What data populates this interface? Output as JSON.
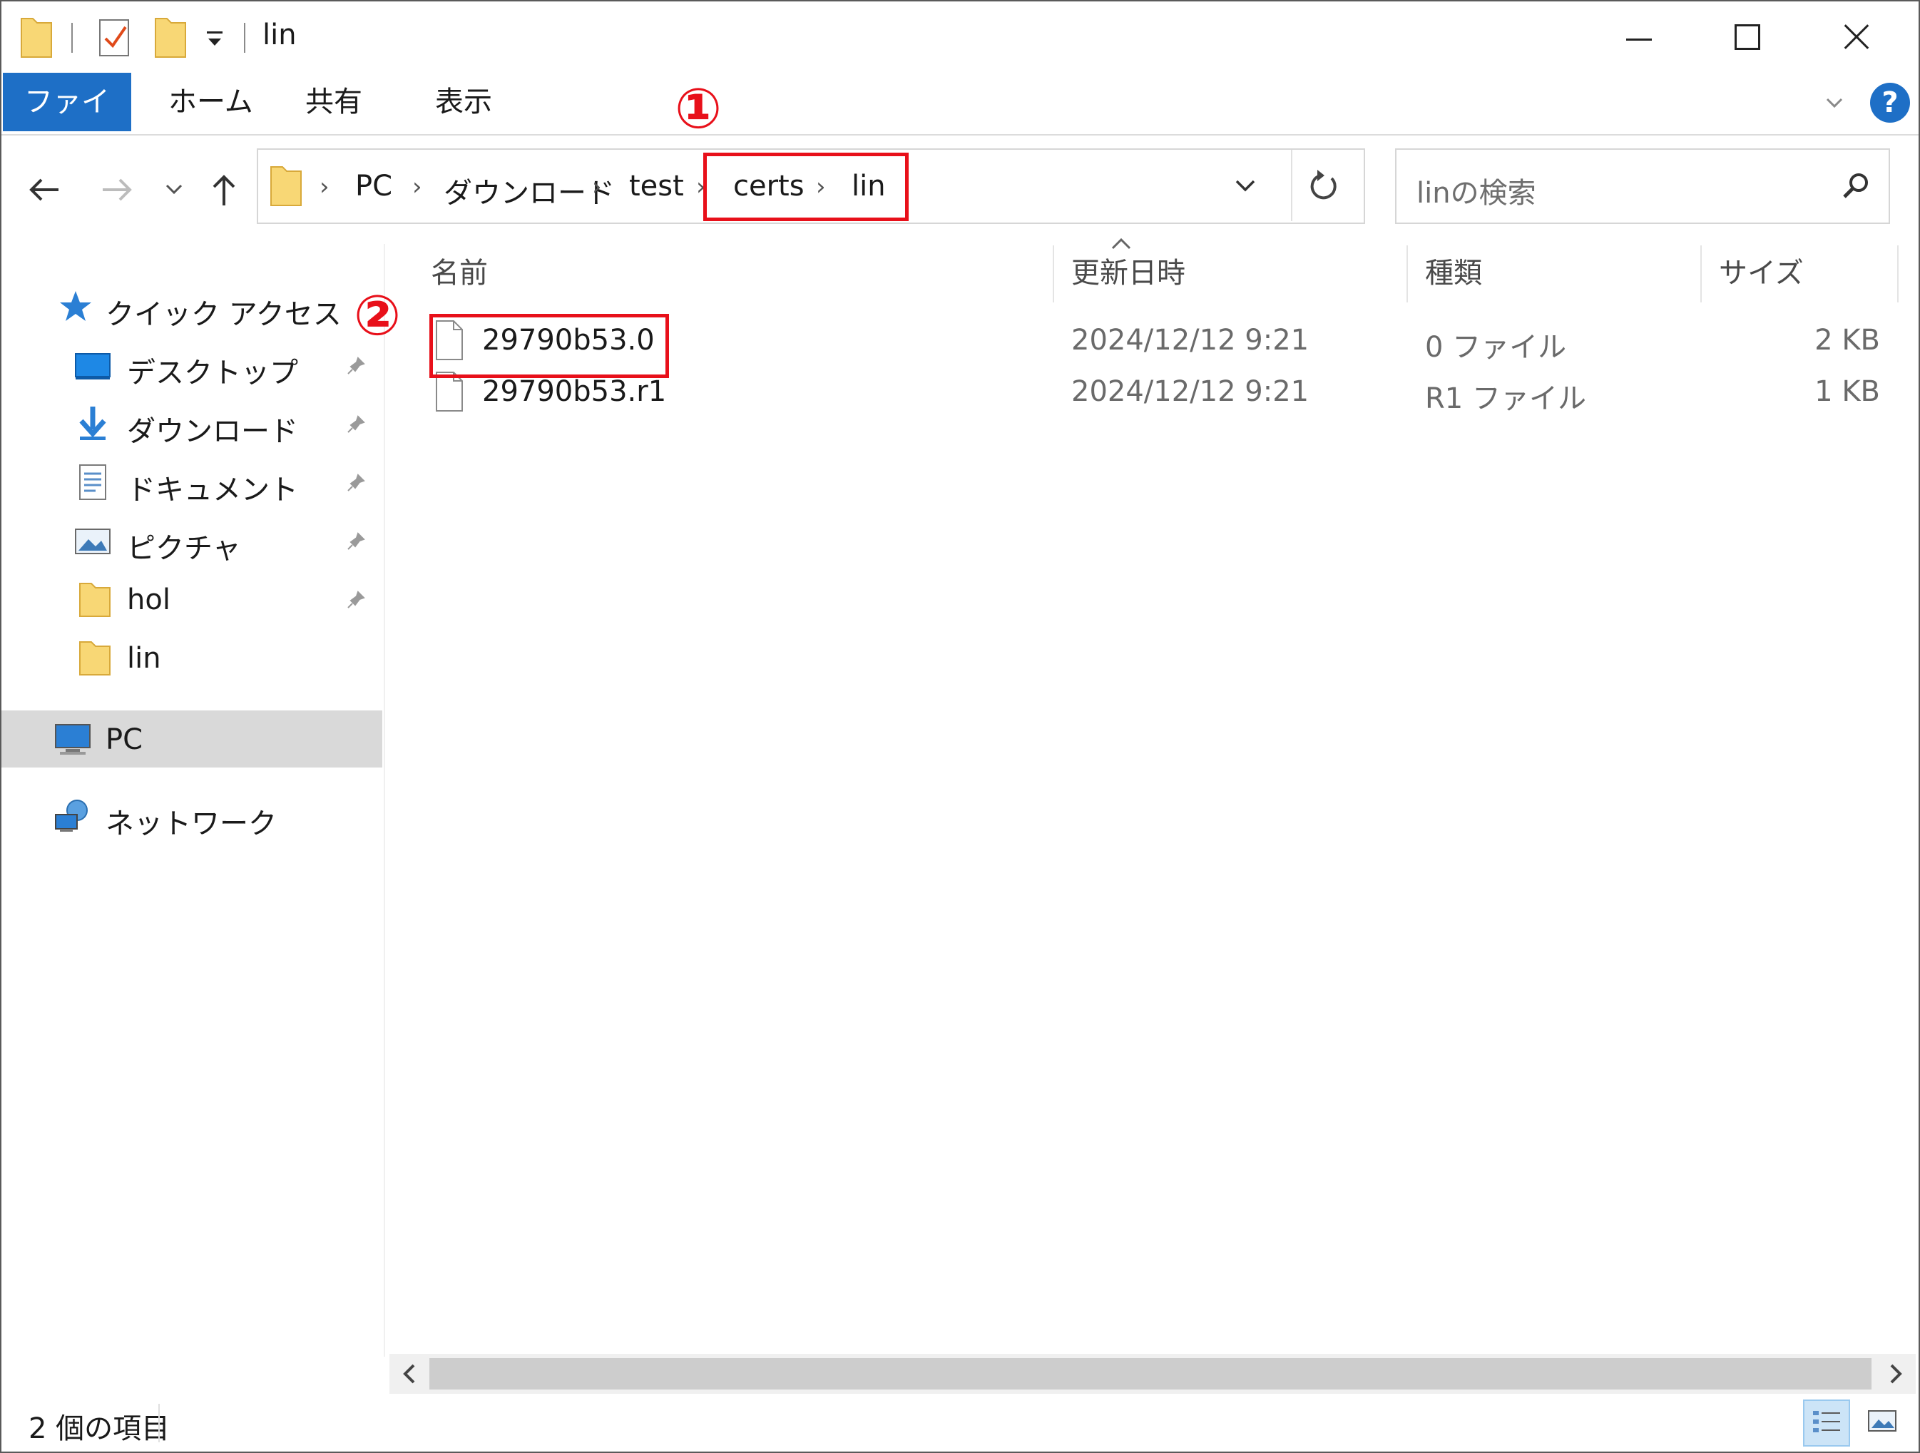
{
  "window": {
    "title": "lin"
  },
  "ribbon": {
    "tabs": [
      {
        "label": "ファイル"
      },
      {
        "label": "ホーム"
      },
      {
        "label": "共有"
      },
      {
        "label": "表示"
      }
    ],
    "help_label": "?"
  },
  "address": {
    "crumbs": [
      "PC",
      "ダウンロード",
      "test",
      "certs",
      "lin"
    ],
    "search_placeholder": "linの検索"
  },
  "sidebar": {
    "quick_access": "クイック アクセス",
    "items": [
      {
        "label": "デスクトップ",
        "icon": "desktop-icon",
        "pinned": true
      },
      {
        "label": "ダウンロード",
        "icon": "download-icon",
        "pinned": true
      },
      {
        "label": "ドキュメント",
        "icon": "document-icon",
        "pinned": true
      },
      {
        "label": "ピクチャ",
        "icon": "pictures-icon",
        "pinned": true
      },
      {
        "label": "hol",
        "icon": "folder-icon",
        "pinned": true
      },
      {
        "label": "lin",
        "icon": "folder-icon",
        "pinned": false
      }
    ],
    "pc": "PC",
    "network": "ネットワーク"
  },
  "columns": [
    "名前",
    "更新日時",
    "種類",
    "サイズ"
  ],
  "files": [
    {
      "name": "29790b53.0",
      "date": "2024/12/12 9:21",
      "type": "0 ファイル",
      "size": "2 KB"
    },
    {
      "name": "29790b53.r1",
      "date": "2024/12/12 9:21",
      "type": "R1 ファイル",
      "size": "1 KB"
    }
  ],
  "annotations": [
    "①",
    "②"
  ],
  "status": {
    "item_count": "2 個の項目"
  },
  "colors": {
    "accent": "#1e6fc6",
    "annotation": "#e8101a",
    "folder": "#f8d775",
    "selection": "#d9d9d9"
  }
}
